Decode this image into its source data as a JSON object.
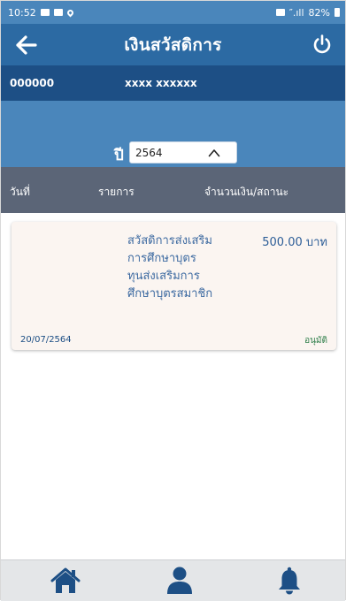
{
  "status_bar": {
    "time": "10:52",
    "signal_text": "″.ıll",
    "battery": "82%"
  },
  "header": {
    "title": "เงินสวัสดิการ",
    "back_icon": "arrow-left-icon",
    "power_icon": "power-icon"
  },
  "member": {
    "id": "000000",
    "name": "xxxx xxxxxx"
  },
  "year_filter": {
    "label": "ปี",
    "value": "2564"
  },
  "columns": {
    "date": "วันที่",
    "item": "รายการ",
    "amount_status": "จำนวนเงิน/สถานะ"
  },
  "records": [
    {
      "description_lines": [
        "สวัสดิการส่งเสริม",
        "การศึกษาบุตร",
        "ทุนส่งเสริมการ",
        "ศึกษาบุตรสมาชิก"
      ],
      "amount": "500.00 บาท",
      "date": "20/07/2564",
      "status": "อนุมัติ"
    }
  ],
  "bottom_nav": [
    "home-icon",
    "user-icon",
    "bell-icon"
  ],
  "colors": {
    "status_bar": "#4a86bb",
    "header": "#2c6aa3",
    "member_bar": "#1d4f85",
    "column_header": "#5b6577",
    "nav_icon": "#1d4f85",
    "status_approved": "#2c7d48"
  }
}
